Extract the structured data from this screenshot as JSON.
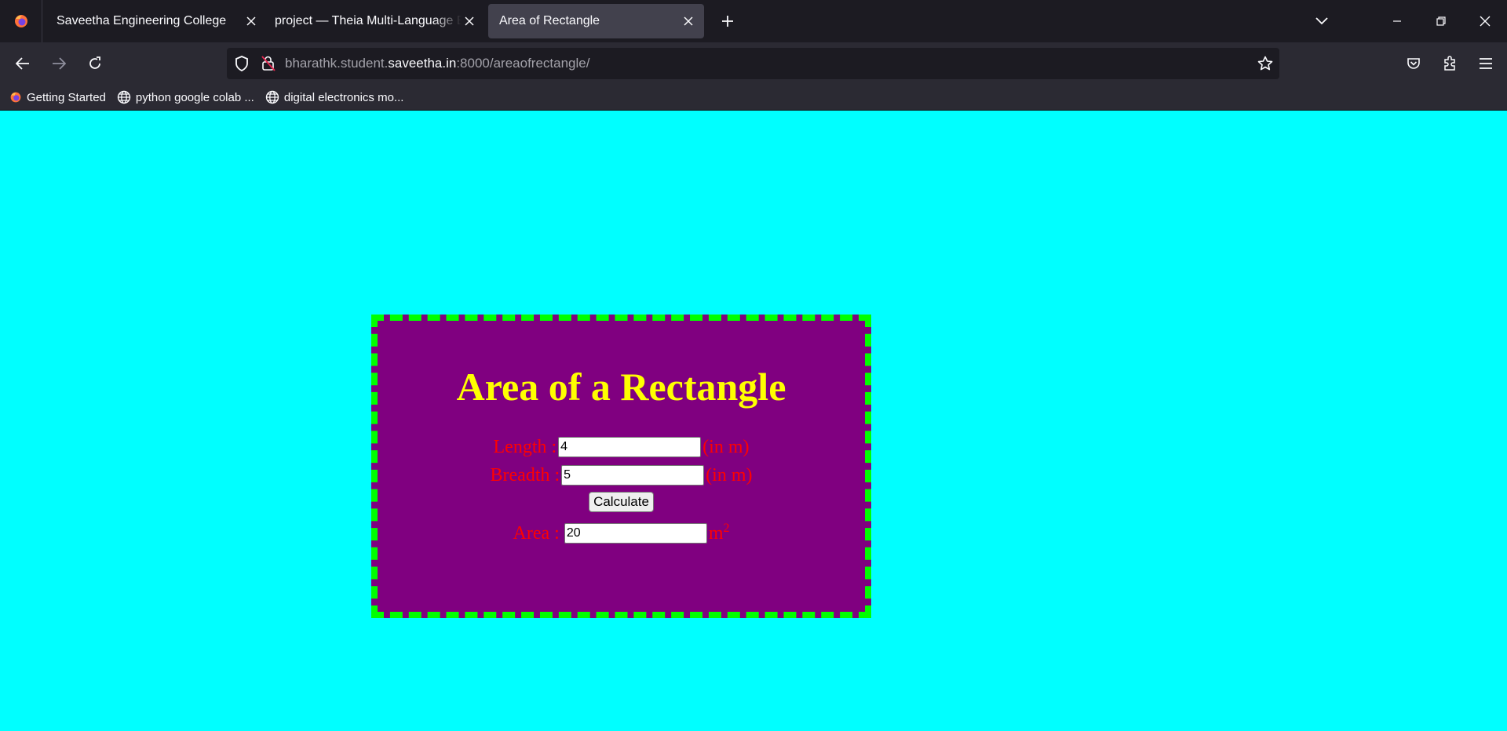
{
  "browser": {
    "tabs": [
      {
        "title": "Saveetha Engineering College",
        "active": false
      },
      {
        "title": "project — Theia Multi-Language Ex",
        "active": false
      },
      {
        "title": "Area of Rectangle",
        "active": true
      }
    ],
    "url": {
      "prefix": "bharathk.student.",
      "host": "saveetha.in",
      "suffix": ":8000/areaofrectangle/"
    },
    "bookmarks": [
      {
        "label": "Getting Started",
        "icon": "firefox-icon"
      },
      {
        "label": "python google colab ...",
        "icon": "globe-icon"
      },
      {
        "label": "digital electronics mo...",
        "icon": "globe-icon"
      }
    ]
  },
  "page": {
    "colors": {
      "background": "#00ffff",
      "card": "#800080",
      "border": "#00ff00",
      "title": "#ffff00",
      "labels": "#ff0000"
    },
    "title": "Area of a Rectangle",
    "length": {
      "label": "Length :",
      "value": "4",
      "unit": "(in m)"
    },
    "breadth": {
      "label": "Breadth :",
      "value": "5",
      "unit": "(in m)"
    },
    "calculate_label": "Calculate",
    "area": {
      "label": "Area :",
      "value": "20",
      "unit": "m",
      "exponent": "2"
    }
  }
}
